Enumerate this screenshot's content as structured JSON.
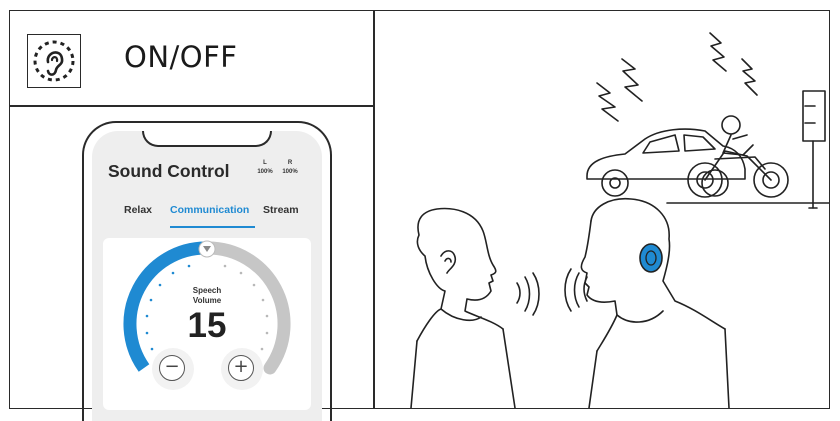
{
  "header": {
    "toggle_label": "ON/OFF"
  },
  "app": {
    "title": "Sound Control",
    "battery": [
      {
        "side": "L",
        "level": "100%"
      },
      {
        "side": "R",
        "level": "100%"
      }
    ],
    "tabs": [
      "Relax",
      "Communication",
      "Stream"
    ],
    "active_tab": "Communication",
    "control": {
      "label_line1": "Speech",
      "label_line2": "Volume",
      "value": "15",
      "minus_symbol": "−",
      "plus_symbol": "+"
    }
  },
  "icons": {
    "toggle": "ear-icon",
    "scene_earbud": "earbud-icon"
  },
  "colors": {
    "accent": "#1f8ad2",
    "track": "#c6c6c6"
  }
}
